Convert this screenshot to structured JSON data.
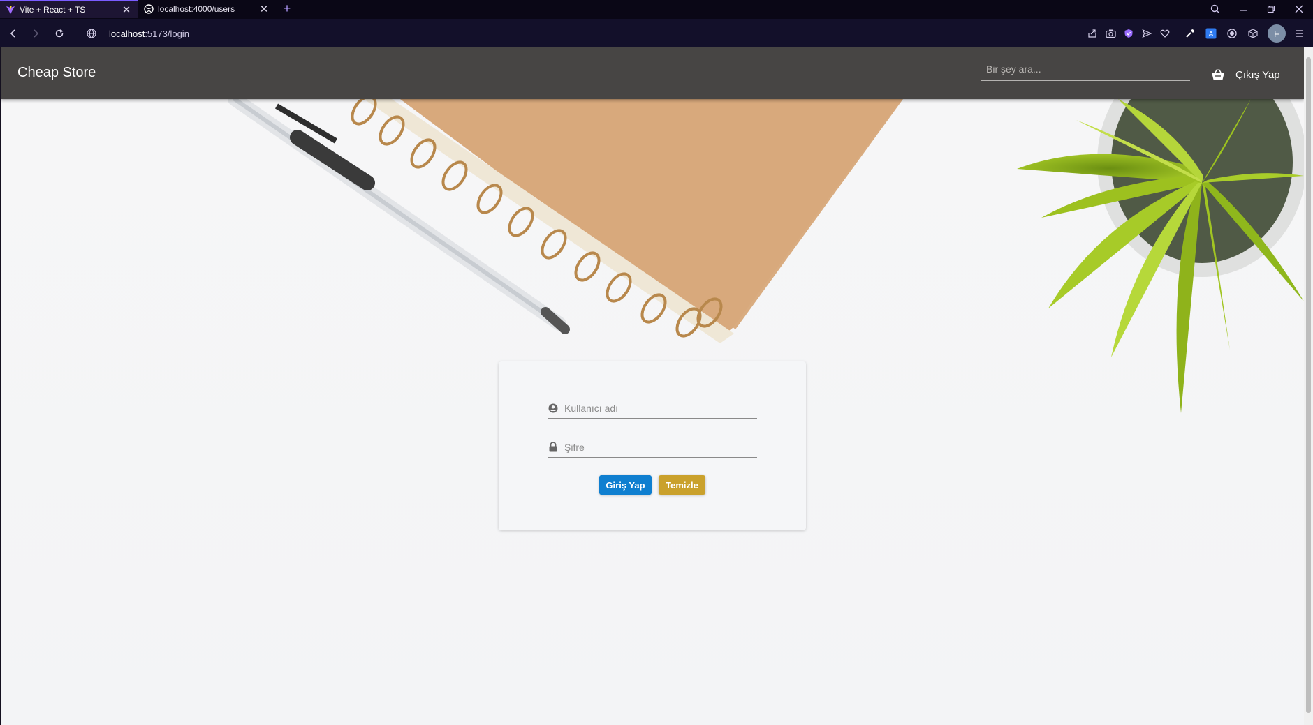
{
  "browser": {
    "tabs": [
      {
        "title": "Vite + React + TS",
        "active": true,
        "favicon": "vite-logo-icon"
      },
      {
        "title": "localhost:4000/users",
        "active": false,
        "favicon": "globe-icon"
      }
    ],
    "url": {
      "host": "localhost",
      "path": ":5173/login"
    },
    "profile_initial": "F"
  },
  "app": {
    "brand": "Cheap Store",
    "search_placeholder": "Bir şey ara...",
    "logout_label": "Çıkış Yap"
  },
  "login": {
    "username_placeholder": "Kullanıcı adı",
    "password_placeholder": "Şifre",
    "submit_label": "Giriş Yap",
    "clear_label": "Temizle"
  },
  "colors": {
    "appbar": "#474544",
    "login_button": "#0f7fd0",
    "clear_button": "#caa12c",
    "browser_accent": "#7a5cff"
  }
}
